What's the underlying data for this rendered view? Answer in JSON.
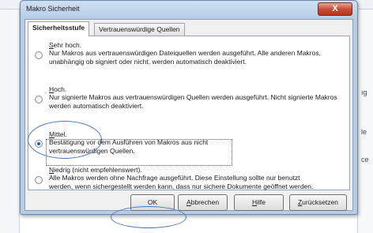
{
  "background_app": {
    "fragments": [
      "ıg",
      "le",
      "ce"
    ]
  },
  "dialog": {
    "title": "Makro Sicherheit",
    "close_symbol": "X",
    "tabs": [
      {
        "label": "Sicherheitsstufe",
        "active": true
      },
      {
        "label": "Vertrauenswürdige Quellen",
        "active": false
      }
    ],
    "options": [
      {
        "label_mnemonic": "S",
        "label_rest": "ehr hoch.",
        "description": "Nur Makros aus vertrauenswürdigen Dateiquellen werden ausgeführt. Alle anderen Makros, unabhängig ob signiert oder nicht, werden automatisch deaktiviert.",
        "checked": false
      },
      {
        "label_mnemonic": "H",
        "label_rest": "och.",
        "description": "Nur signierte Makros aus vertrauenswürdigen Quellen werden ausgeführt. Nicht signierte Makros werden automatisch deaktiviert.",
        "checked": false
      },
      {
        "label_mnemonic": "M",
        "label_rest": "ittel.",
        "description": "Bestätigung vor dem Ausführen von Makros aus nicht vertrauenswürdigen Quellen.",
        "checked": true
      },
      {
        "label_mnemonic": "N",
        "label_rest": "iedrig (nicht empfehlenswert).",
        "description": "Alle Makros werden ohne Nachfrage ausgeführt. Diese Einstellung sollte nur benutzt werden, wenn sichergestellt werden kann, dass nur sichere Dokumente geöffnet werden.",
        "checked": false
      }
    ],
    "buttons": {
      "ok": "OK",
      "cancel_mnemonic": "A",
      "cancel_rest": "bbrechen",
      "help_mnemonic": "H",
      "help_rest": "ilfe",
      "reset_mnemonic": "Z",
      "reset_rest": "urücksetzen"
    }
  },
  "colors": {
    "annotation": "#4a78c0",
    "close_button": "#c8503a",
    "radio_selected": "#1f5fb4"
  }
}
